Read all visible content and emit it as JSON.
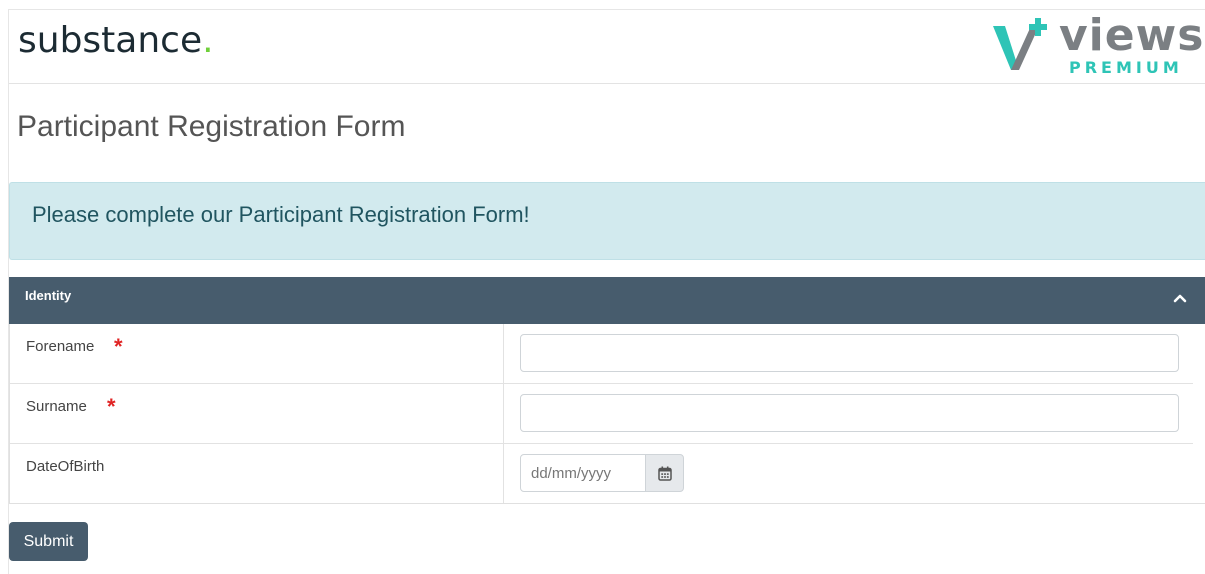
{
  "header": {
    "brand_left": "substance",
    "brand_left_dot": ".",
    "brand_right_word": "views",
    "brand_right_sub": "PREMIUM"
  },
  "page": {
    "title": "Participant Registration Form"
  },
  "alert": {
    "message": "Please complete our Participant Registration Form!"
  },
  "panel": {
    "title": "Identity",
    "collapse_icon": "chevron-up-icon",
    "fields": [
      {
        "label": "Forename",
        "required": true,
        "value": ""
      },
      {
        "label": "Surname",
        "required": true,
        "value": ""
      },
      {
        "label": "DateOfBirth",
        "required": false,
        "placeholder": "dd/mm/yyyy",
        "icon": "calendar-icon"
      }
    ]
  },
  "required_marker": "*",
  "actions": {
    "submit_label": "Submit"
  },
  "colors": {
    "panel_header": "#475c6d",
    "alert_bg": "#d2eaee",
    "alert_text": "#205560",
    "required": "#e02424",
    "brand_accent": "#2ec4b6"
  }
}
